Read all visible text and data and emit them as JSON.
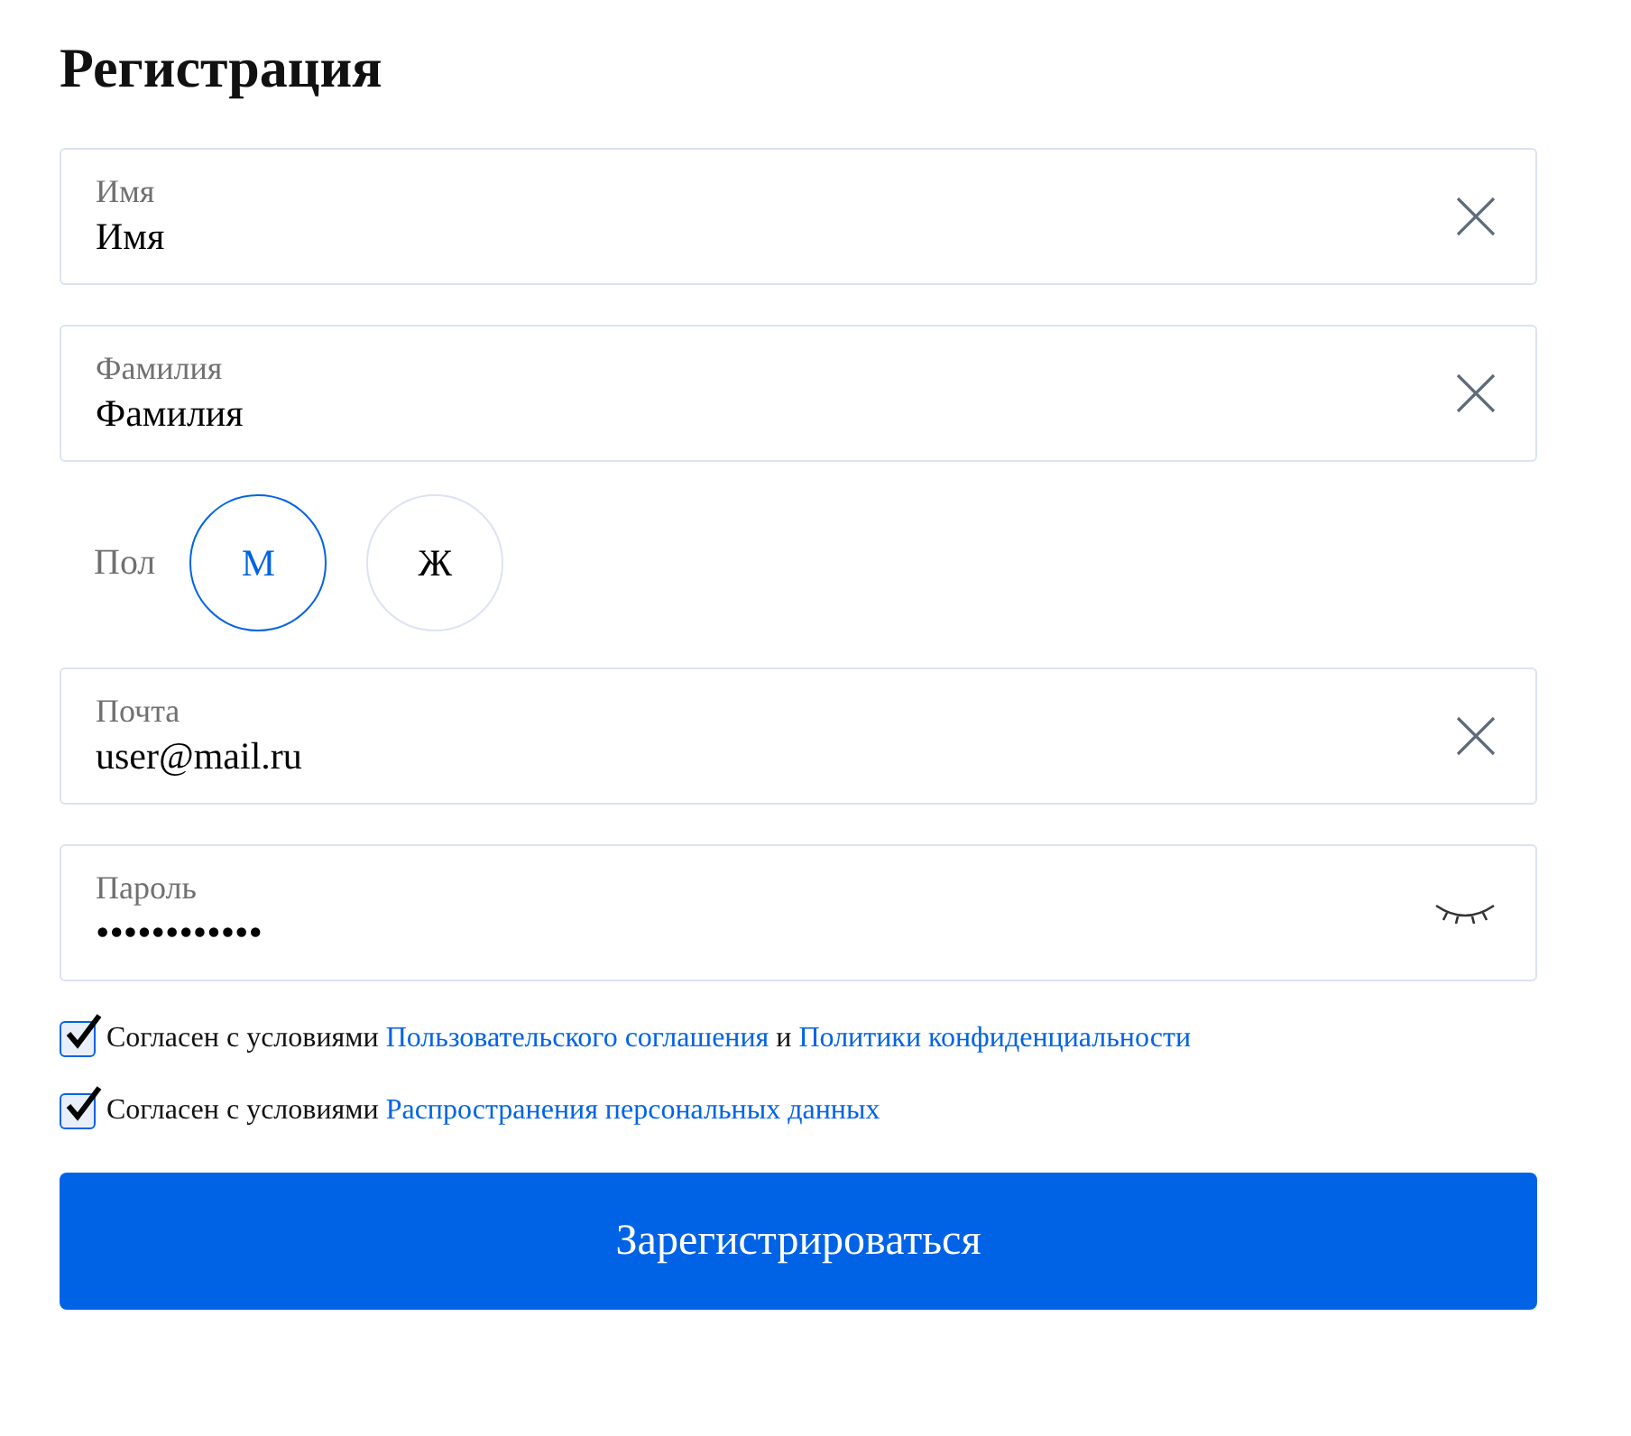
{
  "title": "Регистрация",
  "fields_top": [
    {
      "kind": "clear",
      "label": "Имя",
      "value": "Имя"
    },
    {
      "kind": "clear",
      "label": "Фамилия",
      "value": "Фамилия"
    }
  ],
  "gender": {
    "label": "Пол",
    "options": [
      {
        "label": "М",
        "selected": true
      },
      {
        "label": "Ж",
        "selected": false
      }
    ]
  },
  "fields_bottom": [
    {
      "kind": "clear",
      "label": "Почта",
      "value": "user@mail.ru"
    },
    {
      "kind": "password",
      "label": "Пароль",
      "value": "••••••••••••"
    }
  ],
  "agreements": [
    {
      "checked": true,
      "parts": [
        {
          "kind": "text",
          "text": "Согласен с условиями "
        },
        {
          "kind": "link",
          "text": "Пользовательского соглашения"
        },
        {
          "kind": "text",
          "text": " и "
        },
        {
          "kind": "link",
          "text": "Политики конфиденциальности"
        }
      ]
    },
    {
      "checked": true,
      "parts": [
        {
          "kind": "text",
          "text": "Согласен с условиями "
        },
        {
          "kind": "link",
          "text": "Распространения персональных данных"
        }
      ]
    }
  ],
  "submit": "Зарегистрироваться"
}
